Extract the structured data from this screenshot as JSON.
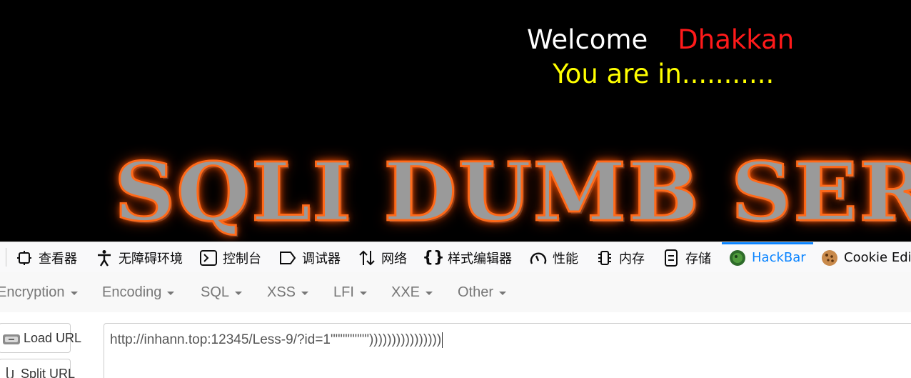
{
  "web": {
    "welcome_text": "Welcome",
    "username": "Dhakkan",
    "status": "You are in...........",
    "banner_text": "SQLI DUMB SERIES"
  },
  "devtools": {
    "tabs": [
      {
        "label": "查看器",
        "icon": "inspector-icon"
      },
      {
        "label": "无障碍环境",
        "icon": "accessibility-icon"
      },
      {
        "label": "控制台",
        "icon": "console-icon"
      },
      {
        "label": "调试器",
        "icon": "debugger-icon"
      },
      {
        "label": "网络",
        "icon": "network-icon"
      },
      {
        "label": "样式编辑器",
        "icon": "style-editor-icon"
      },
      {
        "label": "性能",
        "icon": "performance-icon"
      },
      {
        "label": "内存",
        "icon": "memory-icon"
      },
      {
        "label": "存储",
        "icon": "storage-icon"
      },
      {
        "label": "HackBar",
        "icon": "hackbar-icon",
        "active": true
      },
      {
        "label": "Cookie Edit",
        "icon": "cookie-icon"
      }
    ],
    "active_color": "#0a84ff"
  },
  "hackbar": {
    "menu": [
      "Encryption",
      "Encoding",
      "SQL",
      "XSS",
      "LFI",
      "XXE",
      "Other"
    ],
    "load_url_label": "Load URL",
    "split_url_label": "Split URL",
    "url_value": "http://inhann.top:12345/Less-9/?id=1\"\"\"\"\"\"\"\"))))))))))))))))"
  }
}
